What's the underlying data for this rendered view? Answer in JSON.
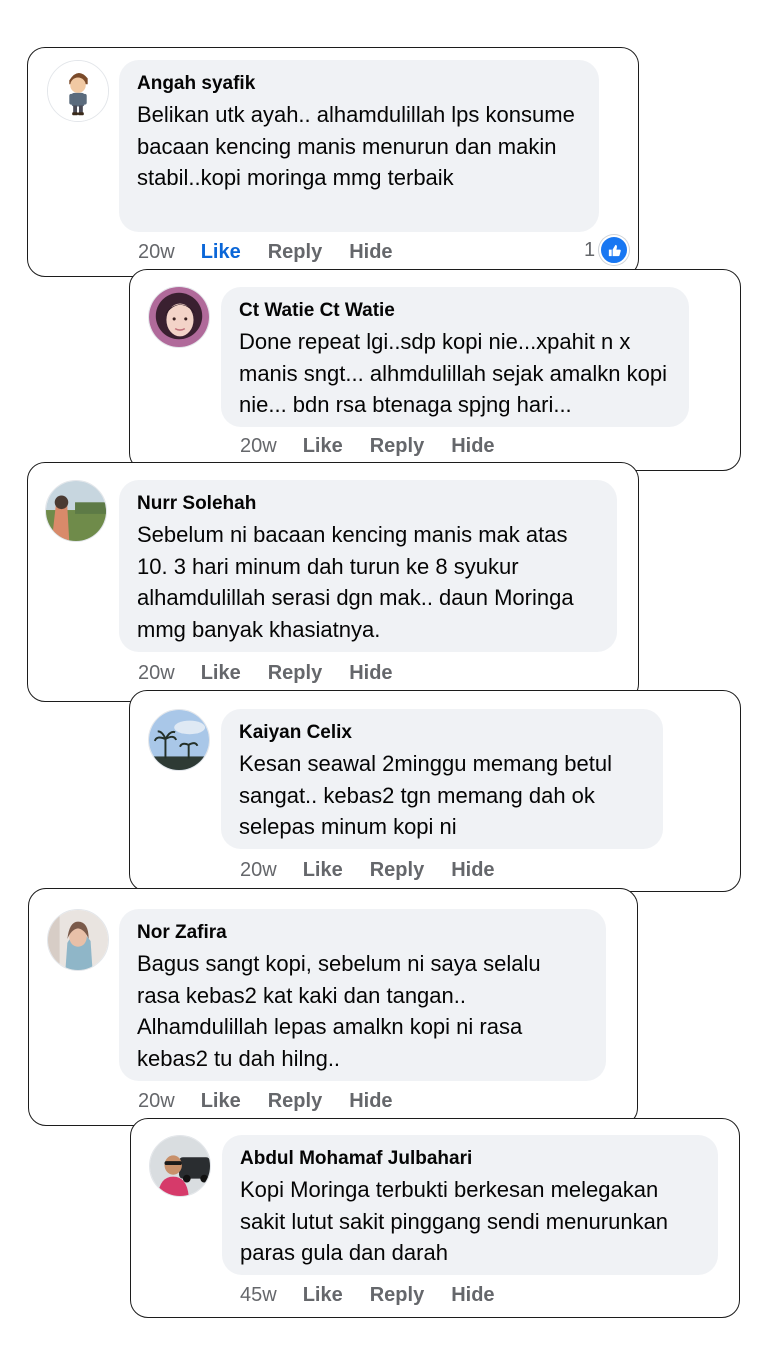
{
  "comments": [
    {
      "name": "Angah syafik",
      "text": "Belikan utk ayah.. alhamdulillah lps konsume bacaan kencing manis menurun dan makin stabil..kopi moringa mmg terbaik",
      "time": "20w",
      "like": "Like",
      "reply": "Reply",
      "hide": "Hide",
      "reaction_count": "1",
      "reaction_icon": "like-thumb-icon",
      "avatar_icon": "cartoon-boy-icon"
    },
    {
      "name": "Ct Watie Ct Watie",
      "text": "Done repeat lgi..sdp kopi nie...xpahit n x manis sngt... alhmdulillah sejak amalkn kopi nie... bdn rsa  btenaga spjng hari...",
      "time": "20w",
      "like": "Like",
      "reply": "Reply",
      "hide": "Hide",
      "avatar_icon": "woman-portrait-icon"
    },
    {
      "name": "Nurr Solehah",
      "text": "Sebelum ni bacaan kencing manis mak atas 10. 3 hari minum dah turun ke 8 syukur alhamdulillah serasi dgn mak.. daun Moringa mmg banyak khasiatnya.",
      "time": "20w",
      "like": "Like",
      "reply": "Reply",
      "hide": "Hide",
      "avatar_icon": "outdoor-field-icon"
    },
    {
      "name": "Kaiyan Celix",
      "text": "Kesan seawal 2minggu memang betul sangat.. kebas2 tgn memang dah ok selepas minum kopi ni",
      "time": "20w",
      "like": "Like",
      "reply": "Reply",
      "hide": "Hide",
      "avatar_icon": "sky-palm-trees-icon"
    },
    {
      "name": "Nor Zafira",
      "text": "Bagus  sangt kopi,  sebelum ni saya selalu rasa kebas2 kat kaki dan tangan.. Alhamdulillah  lepas amalkn kopi ni rasa kebas2 tu dah hilng..",
      "time": "20w",
      "like": "Like",
      "reply": "Reply",
      "hide": "Hide",
      "avatar_icon": "hijab-woman-icon"
    },
    {
      "name": "Abdul Mohamaf Julbahari",
      "text": "Kopi Moringa terbukti berkesan melegakan sakit lutut sakit pinggang sendi menurunkan paras gula dan darah",
      "time": "45w",
      "like": "Like",
      "reply": "Reply",
      "hide": "Hide",
      "avatar_icon": "man-with-car-icon"
    }
  ],
  "colors": {
    "bubble": "#f0f2f5",
    "meta_gray": "#65676b",
    "like_active": "#0a66d8",
    "reaction_blue": "#1877f2"
  }
}
